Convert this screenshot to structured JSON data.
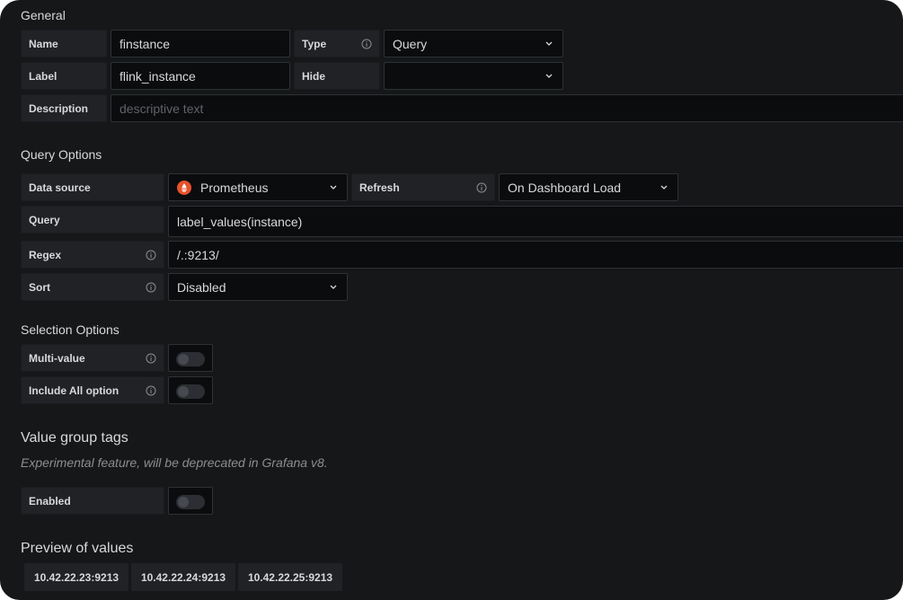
{
  "general": {
    "title": "General",
    "name_label": "Name",
    "name_value": "finstance",
    "type_label": "Type",
    "type_value": "Query",
    "label_label": "Label",
    "label_value": "flink_instance",
    "hide_label": "Hide",
    "hide_value": "",
    "description_label": "Description",
    "description_placeholder": "descriptive text"
  },
  "query_options": {
    "title": "Query Options",
    "datasource_label": "Data source",
    "datasource_value": "Prometheus",
    "datasource_icon": "prometheus-icon",
    "refresh_label": "Refresh",
    "refresh_value": "On Dashboard Load",
    "query_label": "Query",
    "query_value": "label_values(instance)",
    "regex_label": "Regex",
    "regex_value": "/.:9213/",
    "sort_label": "Sort",
    "sort_value": "Disabled"
  },
  "selection_options": {
    "title": "Selection Options",
    "multi_value_label": "Multi-value",
    "multi_value_enabled": false,
    "include_all_label": "Include All option",
    "include_all_enabled": false
  },
  "value_group_tags": {
    "title": "Value group tags",
    "note": "Experimental feature, will be deprecated in Grafana v8.",
    "enabled_label": "Enabled",
    "enabled": false
  },
  "preview": {
    "title": "Preview of values",
    "values": [
      "10.42.22.23:9213",
      "10.42.22.24:9213",
      "10.42.22.25:9213"
    ]
  },
  "colors": {
    "background": "#161719",
    "label_bg": "#202226",
    "input_bg": "#0b0c0e",
    "border": "#2c3235",
    "prometheus": "#e6522c"
  }
}
